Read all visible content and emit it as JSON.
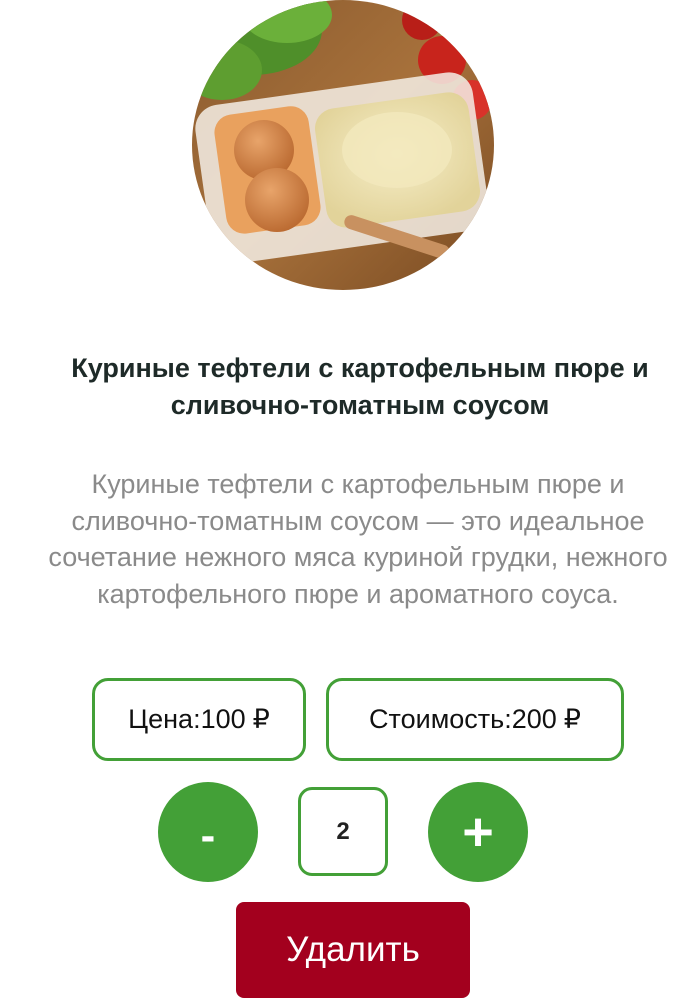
{
  "product": {
    "image_alt": "dish-photo",
    "title": "Куриные тефтели с картофельным пюре и сливочно-томатным соусом",
    "description": "Куриные тефтели с картофельным пюре и сливочно-томатным соусом — это идеальное сочетание нежного мяса куриной грудки, нежного картофельного пюре и ароматного соуса."
  },
  "pricing": {
    "unit_label": "Цена:",
    "unit_value": "100",
    "total_label": "Стоимость:",
    "total_value": "200",
    "currency": "₽"
  },
  "quantity": {
    "decrement_label": "-",
    "value": "2",
    "increment_label": "+"
  },
  "actions": {
    "delete_label": "Удалить"
  },
  "colors": {
    "accent_green": "#43a037",
    "delete_red": "#a3001e",
    "title_text": "#1e2a28",
    "description_text": "#8a8a8a"
  }
}
